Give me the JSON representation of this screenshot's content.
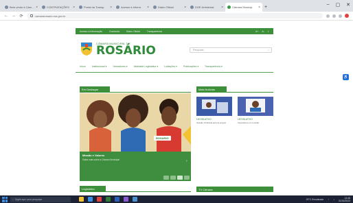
{
  "browser": {
    "tabs": [
      {
        "label": "Bem-vindo à Câmara",
        "favicon": "page",
        "active": false
      },
      {
        "label": "CONTRATAÇÕES",
        "favicon": "page",
        "active": false
      },
      {
        "label": "Portal da Transp.",
        "favicon": "page",
        "active": false
      },
      {
        "label": "Acesso à Inform.",
        "favicon": "page",
        "active": false
      },
      {
        "label": "Diário Oficial",
        "favicon": "page",
        "active": false
      },
      {
        "label": "DOE Ambiental",
        "favicon": "page",
        "active": false
      },
      {
        "label": "Câmara Municip.",
        "favicon": "green",
        "active": true
      }
    ],
    "new_tab": "+",
    "window_controls": {
      "minimize": "–",
      "maximize": "▢",
      "close": "✕"
    },
    "nav": {
      "back": "←",
      "forward": "→",
      "reload": "⟳"
    },
    "url": "camararosario.ma.gov.br"
  },
  "site": {
    "top_links": [
      "Acesso à Informação",
      "Ouvidoria",
      "Diário Oficial",
      "Transparência"
    ],
    "tools": [
      "A+",
      "A-",
      "◐"
    ],
    "logo": {
      "prefix": "CÂMARA MUNICIPAL DE",
      "city": "ROSÁRIO"
    },
    "search_placeholder": "Pesquisar...",
    "menu": [
      "Início",
      "Institucional ▾",
      "Vereadores ▾",
      "Atividade Legislativa ▾",
      "Licitações ▾",
      "Publicações ▾",
      "Transparência ▾"
    ],
    "accessibility_icon": "♿",
    "sections": {
      "highlights": "Em Destaque",
      "news": "Mais Notícias",
      "legislative": "Legislativo",
      "chamber": "TV Câmara"
    },
    "hero": {
      "title_line1": "câmara",
      "title_line2": "municipal",
      "tag": "ROSÁRIO",
      "caption": "Missão e Valores",
      "subcaption": "Saiba mais sobre a Câmara Municipal",
      "arrow": "›"
    },
    "news": [
      {
        "title": "LEGISLATIVO",
        "desc": "Sessão Ordinária aprova projeto"
      },
      {
        "title": "LEGISLATIVO",
        "desc": "Vereadores em reunião"
      }
    ]
  },
  "taskbar": {
    "search_placeholder": "Digite aqui para pesquisar",
    "weather": "29°C Ensolarado",
    "time": "14:46",
    "date": "01/02/2023"
  },
  "colors": {
    "brand_green": "#3d8f3a",
    "taskbar": "#1c2233",
    "accent_blue": "#1e7ad6"
  }
}
